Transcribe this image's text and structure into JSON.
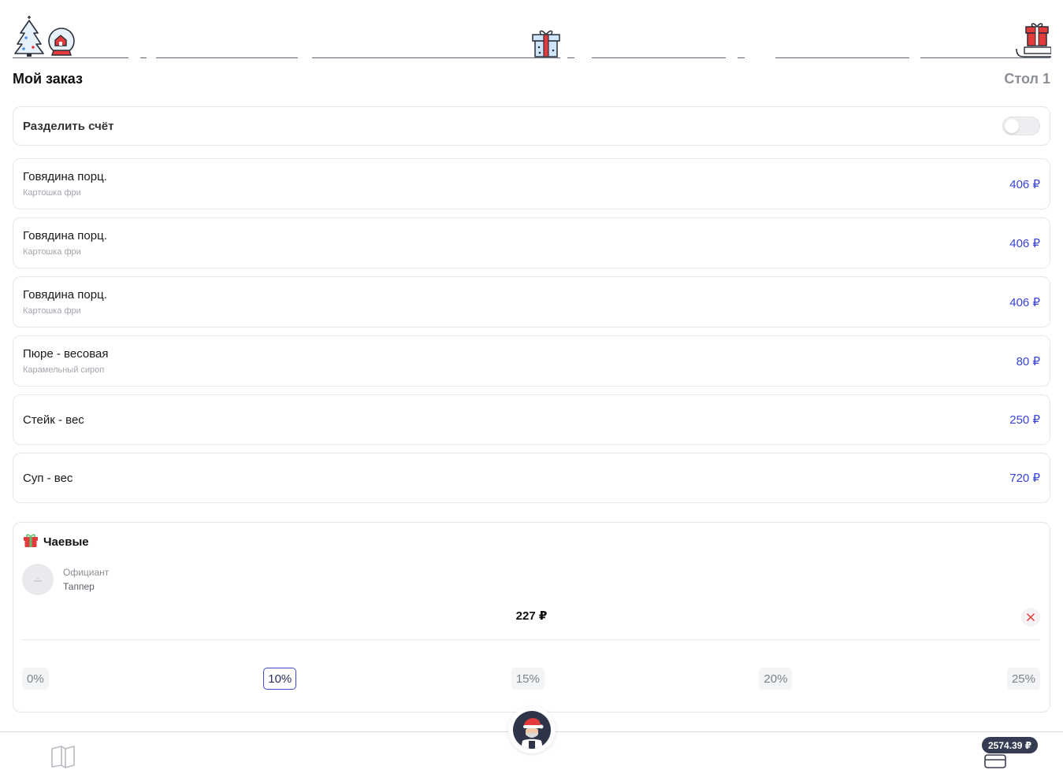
{
  "header": {
    "title": "Мой заказ",
    "table": "Стол 1"
  },
  "split": {
    "label": "Разделить счёт",
    "enabled": false
  },
  "items": [
    {
      "name": "Говядина порц.",
      "modifier": "Картошка фри",
      "price": "406 ₽"
    },
    {
      "name": "Говядина порц.",
      "modifier": "Картошка фри",
      "price": "406 ₽"
    },
    {
      "name": "Говядина порц.",
      "modifier": "Картошка фри",
      "price": "406 ₽"
    },
    {
      "name": "Пюре - весовая",
      "modifier": "Карамельный сироп",
      "price": "80 ₽"
    },
    {
      "name": "Стейк - вес",
      "modifier": "",
      "price": "250 ₽"
    },
    {
      "name": "Суп - вес",
      "modifier": "",
      "price": "720 ₽"
    }
  ],
  "tips": {
    "title": "Чаевые",
    "waiter_role": "Официант",
    "waiter_name": "Таппер",
    "amount": "227 ₽",
    "options": [
      "0%",
      "10%",
      "15%",
      "20%",
      "25%"
    ],
    "selected": "10%"
  },
  "footer": {
    "total": "2574.39 ₽"
  },
  "colors": {
    "price": "#3943d6",
    "accent": "#3f47c9",
    "badge": "#343b52",
    "festive_red": "#e33b3b",
    "festive_blue": "#4a90e2"
  },
  "icons": {
    "festive": [
      "christmas-tree-icon",
      "snow-globe-icon",
      "gift-box-icon",
      "sleigh-gift-icon"
    ],
    "tips": "gift-icon",
    "clear": "close-icon",
    "menu": "book-icon",
    "waiter_avatar": "santa-waiter-avatar-icon",
    "card": "credit-card-icon"
  }
}
